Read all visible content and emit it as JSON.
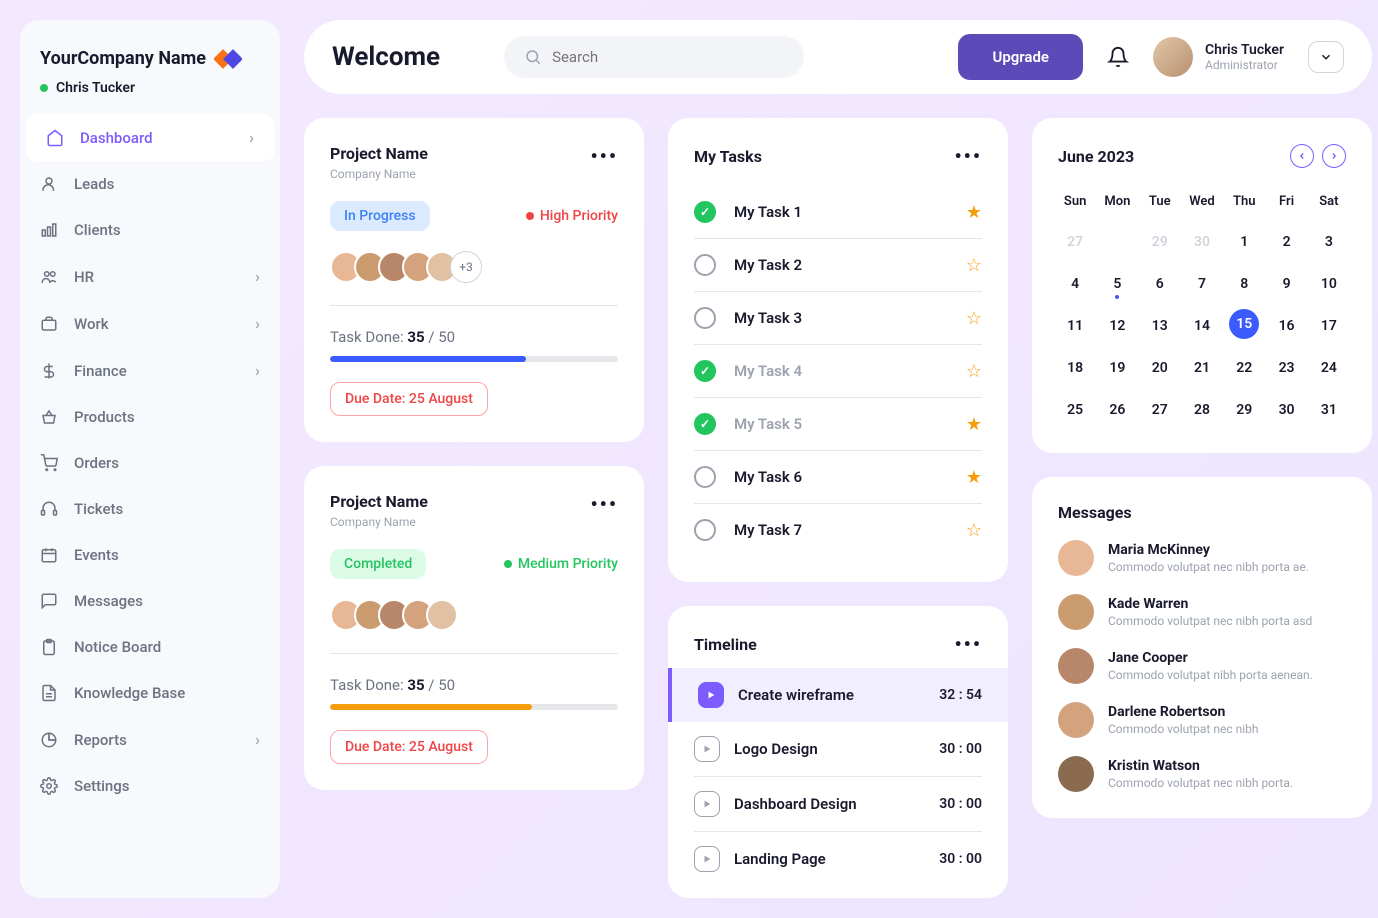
{
  "brand": "YourCompany Name",
  "sidebar_user": "Chris Tucker",
  "nav": [
    {
      "icon": "home",
      "label": "Dashboard",
      "chev": true,
      "active": true
    },
    {
      "icon": "user",
      "label": "Leads",
      "chev": false
    },
    {
      "icon": "bar",
      "label": "Clients",
      "chev": false
    },
    {
      "icon": "users",
      "label": "HR",
      "chev": true
    },
    {
      "icon": "case",
      "label": "Work",
      "chev": true
    },
    {
      "icon": "dollar",
      "label": "Finance",
      "chev": true
    },
    {
      "icon": "basket",
      "label": "Products",
      "chev": false
    },
    {
      "icon": "cart",
      "label": "Orders",
      "chev": false
    },
    {
      "icon": "headset",
      "label": "Tickets",
      "chev": false
    },
    {
      "icon": "calendar",
      "label": "Events",
      "chev": false
    },
    {
      "icon": "chat",
      "label": "Messages",
      "chev": false
    },
    {
      "icon": "clipboard",
      "label": "Notice Board",
      "chev": false
    },
    {
      "icon": "doc",
      "label": "Knowledge Base",
      "chev": false
    },
    {
      "icon": "pie",
      "label": "Reports",
      "chev": true
    },
    {
      "icon": "gear",
      "label": "Settings",
      "chev": false
    }
  ],
  "topbar": {
    "title": "Welcome",
    "search_placeholder": "Search",
    "upgrade": "Upgrade",
    "profile_name": "Chris Tucker",
    "profile_role": "Administrator"
  },
  "projects": [
    {
      "title": "Project Name",
      "company": "Company Name",
      "status": "In Progress",
      "status_cls": "progress",
      "priority": "High Priority",
      "priority_cls": "high",
      "avatars": 5,
      "more": "+3",
      "done": "35",
      "total": "50",
      "pct": 68,
      "bar": "blue",
      "due": "Due Date: 25 August"
    },
    {
      "title": "Project Name",
      "company": "Company Name",
      "status": "Completed",
      "status_cls": "done",
      "priority": "Medium Priority",
      "priority_cls": "med",
      "avatars": 5,
      "more": null,
      "done": "35",
      "total": "50",
      "pct": 70,
      "bar": "ylw",
      "due": "Due Date: 25 August"
    }
  ],
  "tasks_title": "My Tasks",
  "tasks": [
    {
      "done": true,
      "label": "My Task  1",
      "star": true,
      "faded": false
    },
    {
      "done": false,
      "label": "My Task  2",
      "star": false,
      "faded": false
    },
    {
      "done": false,
      "label": "My Task  3",
      "star": false,
      "faded": false
    },
    {
      "done": true,
      "label": "My Task  4",
      "star": false,
      "faded": true
    },
    {
      "done": true,
      "label": "My Task  5",
      "star": true,
      "faded": true
    },
    {
      "done": false,
      "label": "My Task  6",
      "star": true,
      "faded": false
    },
    {
      "done": false,
      "label": "My Task  7",
      "star": false,
      "faded": false
    }
  ],
  "calendar": {
    "title": "June 2023",
    "dow": [
      "Sun",
      "Mon",
      "Tue",
      "Wed",
      "Thu",
      "Fri",
      "Sat"
    ],
    "days": [
      {
        "n": 27,
        "muted": true
      },
      {
        "n": "",
        "muted": true
      },
      {
        "n": 29,
        "muted": true
      },
      {
        "n": 30,
        "muted": true
      },
      {
        "n": 1
      },
      {
        "n": 2
      },
      {
        "n": 3
      },
      {
        "n": 4
      },
      {
        "n": 5,
        "dot": true
      },
      {
        "n": 6
      },
      {
        "n": 7
      },
      {
        "n": 8
      },
      {
        "n": 9
      },
      {
        "n": 10
      },
      {
        "n": 11
      },
      {
        "n": 12
      },
      {
        "n": 13
      },
      {
        "n": 14
      },
      {
        "n": 15,
        "sel": true
      },
      {
        "n": 16
      },
      {
        "n": 17
      },
      {
        "n": 18
      },
      {
        "n": 19
      },
      {
        "n": 20
      },
      {
        "n": 21
      },
      {
        "n": 22
      },
      {
        "n": 23
      },
      {
        "n": 24
      },
      {
        "n": 25
      },
      {
        "n": 26
      },
      {
        "n": 27
      },
      {
        "n": 28
      },
      {
        "n": 29
      },
      {
        "n": 30
      },
      {
        "n": 31
      }
    ]
  },
  "timeline_title": "Timeline",
  "timeline": [
    {
      "name": "Create wireframe",
      "time": "32 : 54",
      "active": true
    },
    {
      "name": "Logo Design",
      "time": "30 : 00",
      "active": false
    },
    {
      "name": "Dashboard Design",
      "time": "30 : 00",
      "active": false
    },
    {
      "name": "Landing Page",
      "time": "30 : 00",
      "active": false
    }
  ],
  "messages_title": "Messages",
  "messages": [
    {
      "name": "Maria McKinney",
      "preview": "Commodo volutpat nec nibh porta ae.",
      "color": "#e8b896"
    },
    {
      "name": "Kade Warren",
      "preview": "Commodo volutpat nec nibh porta  asd",
      "color": "#c99b6e"
    },
    {
      "name": "Jane Cooper",
      "preview": "Commodo volutpat  nibh porta aenean.",
      "color": "#b8876a"
    },
    {
      "name": "Darlene Robertson",
      "preview": "Commodo volutpat nec nibh",
      "color": "#d4a27c"
    },
    {
      "name": "Kristin Watson",
      "preview": "Commodo volutpat nec nibh porta.",
      "color": "#8b6b4f"
    }
  ],
  "task_done_label": "Task Done:"
}
